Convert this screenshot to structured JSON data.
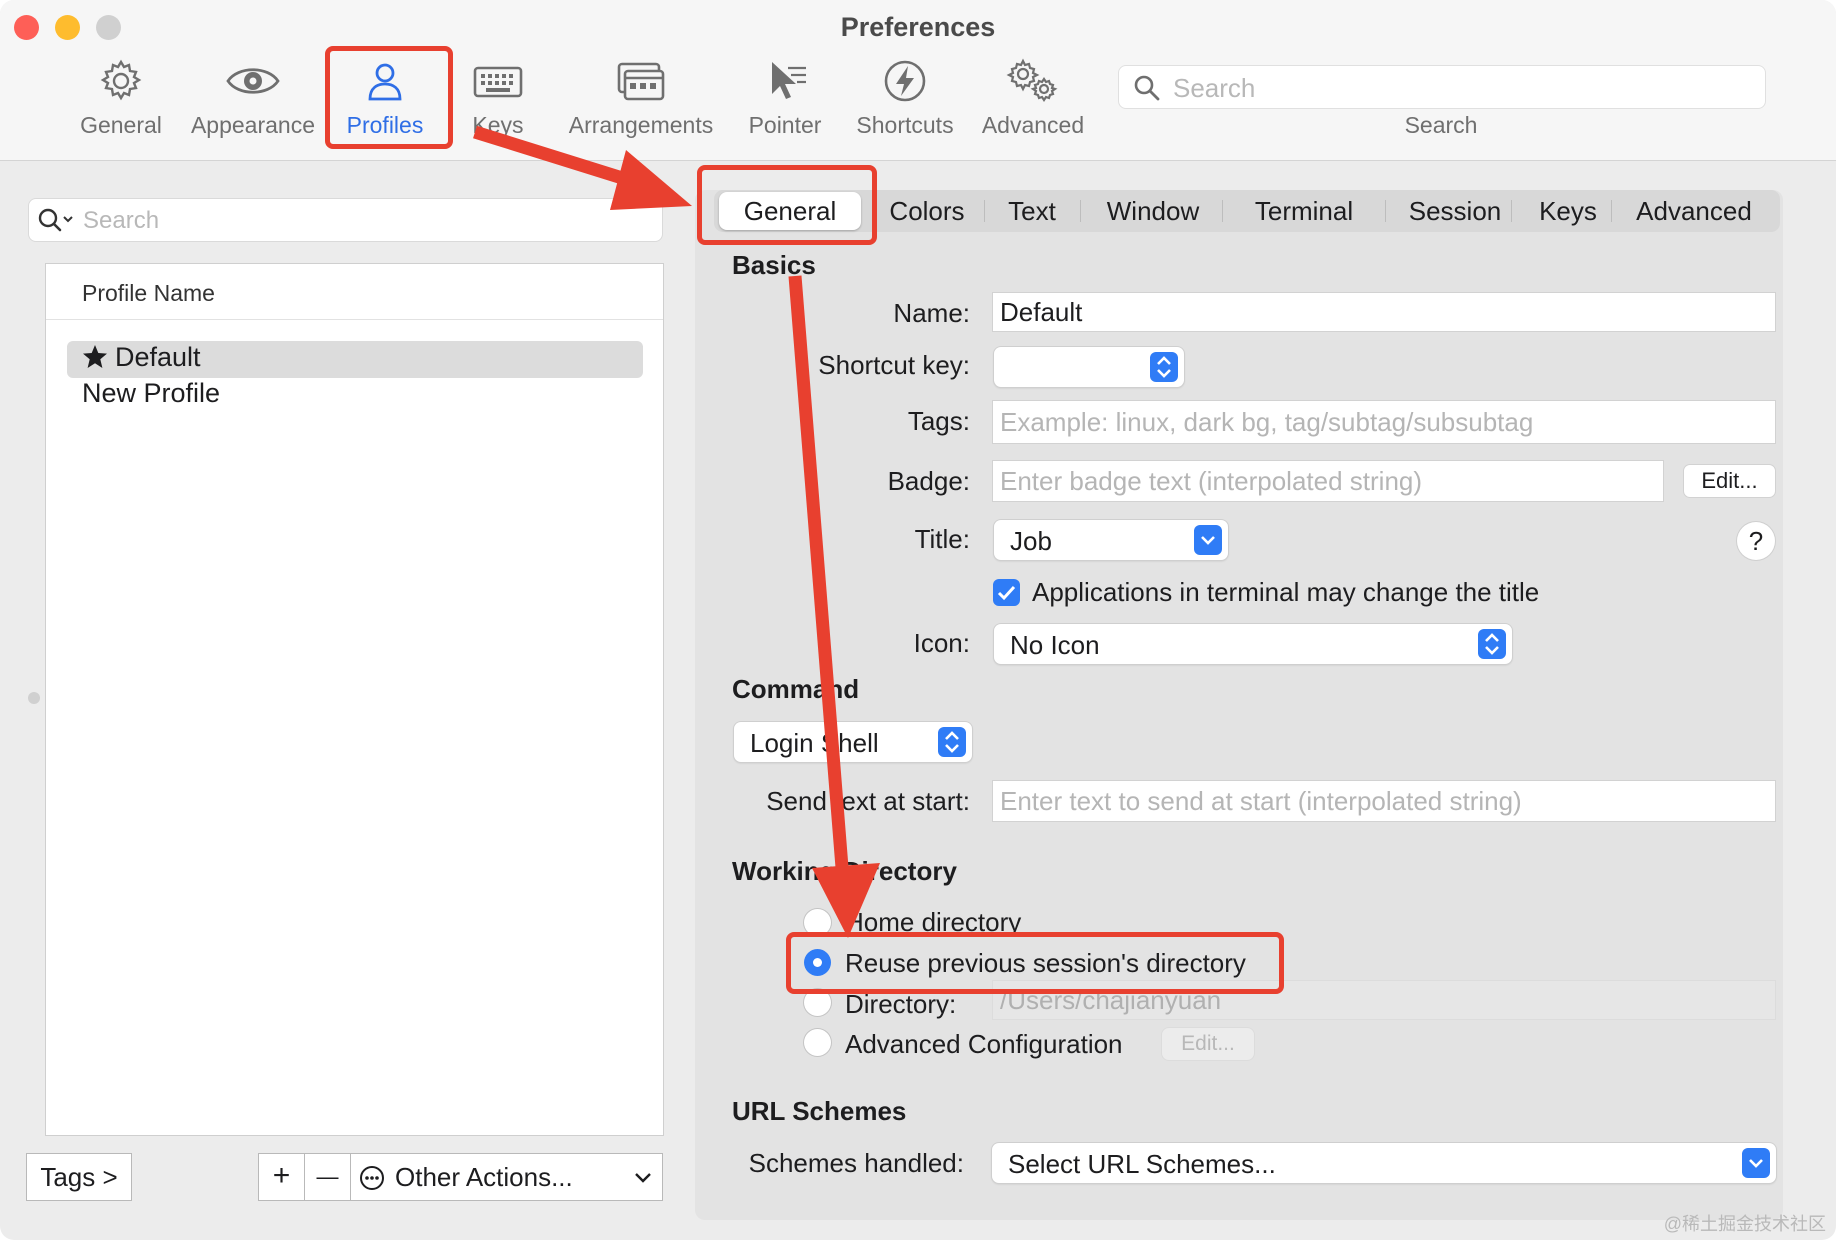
{
  "window": {
    "title": "Preferences",
    "traffic_colors": [
      "#fe5f57",
      "#febc2e",
      "#d0d0d0"
    ]
  },
  "toolbar": {
    "items": [
      {
        "label": "General",
        "icon": "gear-icon"
      },
      {
        "label": "Appearance",
        "icon": "eye-icon"
      },
      {
        "label": "Profiles",
        "icon": "person-icon",
        "selected": true
      },
      {
        "label": "Keys",
        "icon": "keyboard-icon"
      },
      {
        "label": "Arrangements",
        "icon": "windows-icon"
      },
      {
        "label": "Pointer",
        "icon": "cursor-icon"
      },
      {
        "label": "Shortcuts",
        "icon": "lightning-icon"
      },
      {
        "label": "Advanced",
        "icon": "gears-icon"
      }
    ],
    "search_placeholder": "Search",
    "search_label": "Search"
  },
  "sidebar": {
    "search_placeholder": "Search",
    "column_header": "Profile Name",
    "profiles": [
      {
        "name": "Default",
        "starred": true,
        "selected": true
      },
      {
        "name": "New Profile",
        "starred": false,
        "selected": false
      }
    ],
    "tags_button": "Tags >",
    "add_button": "+",
    "remove_button": "—",
    "other_actions": "Other Actions..."
  },
  "tabs": [
    "General",
    "Colors",
    "Text",
    "Window",
    "Terminal",
    "Session",
    "Keys",
    "Advanced"
  ],
  "general": {
    "basics_heading": "Basics",
    "name_label": "Name:",
    "name_value": "Default",
    "shortcut_label": "Shortcut key:",
    "tags_label": "Tags:",
    "tags_placeholder": "Example: linux, dark bg, tag/subtag/subsubtag",
    "badge_label": "Badge:",
    "badge_placeholder": "Enter badge text (interpolated string)",
    "badge_edit": "Edit...",
    "title_label": "Title:",
    "title_value": "Job",
    "help": "?",
    "apps_change_title": "Applications in terminal may change the title",
    "icon_label": "Icon:",
    "icon_value": "No Icon",
    "command_heading": "Command",
    "command_value": "Login Shell",
    "send_text_label": "Send text at start:",
    "send_text_placeholder": "Enter text to send at start (interpolated string)",
    "workdir_heading": "Working Directory",
    "home_dir": "Home directory",
    "reuse_dir": "Reuse previous session's directory",
    "directory_label": "Directory:",
    "directory_value": "/Users/chajianyuan",
    "advanced_config": "Advanced Configuration",
    "advanced_edit": "Edit...",
    "url_heading": "URL Schemes",
    "schemes_label": "Schemes handled:",
    "schemes_value": "Select URL Schemes..."
  },
  "annotation_color": "#e8402f",
  "accent_color": "#2f7cf6",
  "watermark": "@稀土掘金技术社区"
}
